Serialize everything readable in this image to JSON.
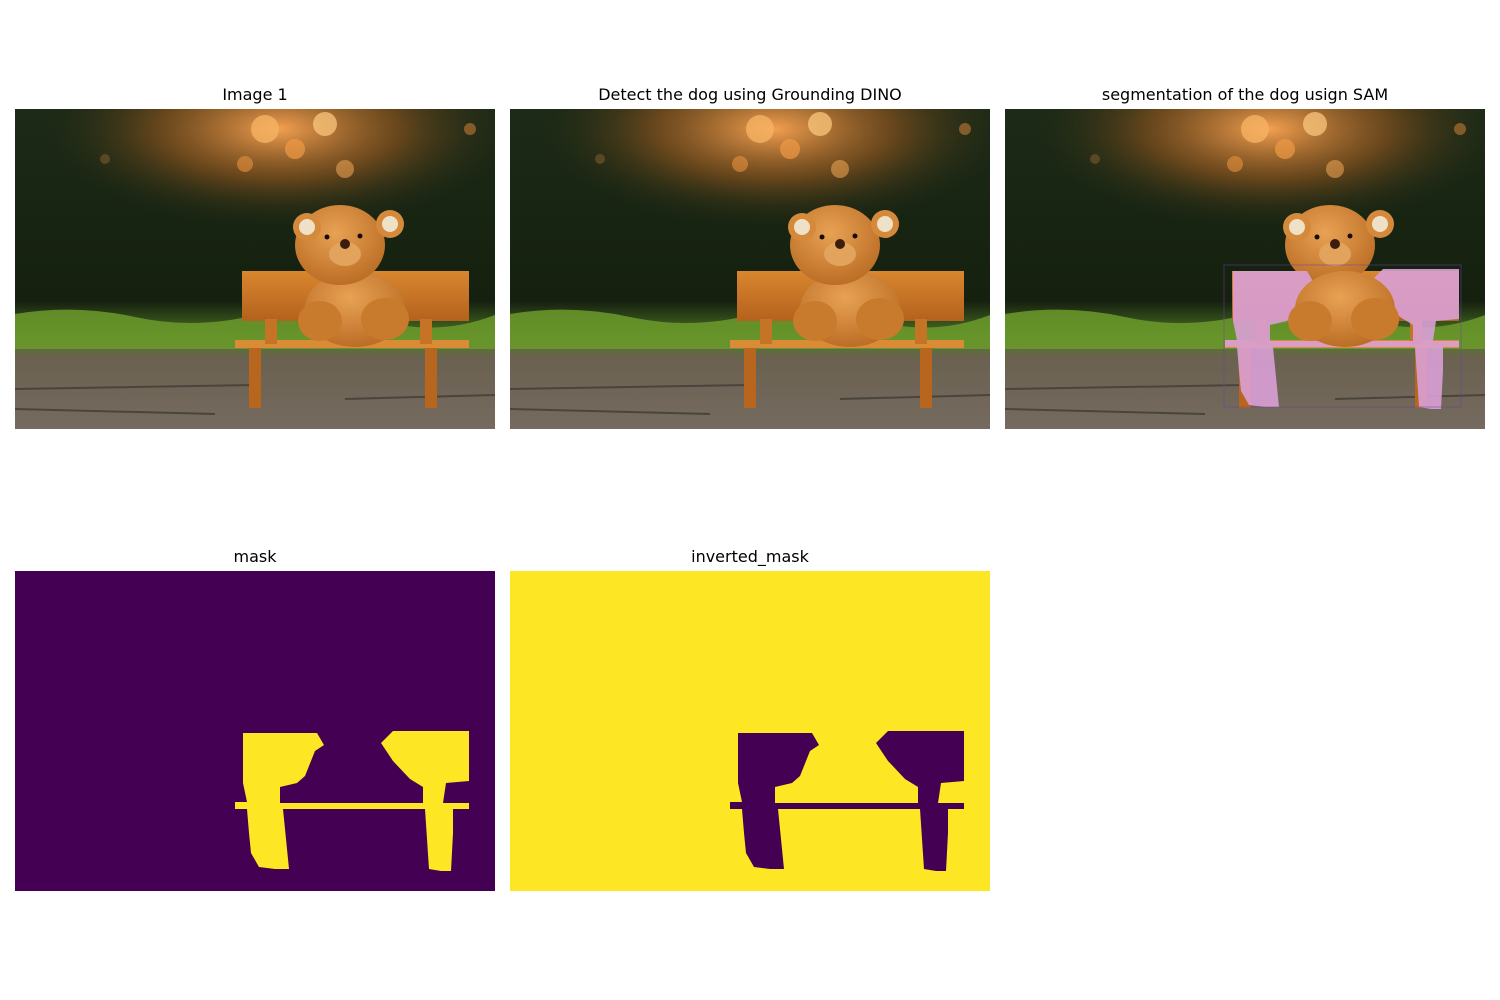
{
  "figure": {
    "panels": [
      {
        "title": "Image 1",
        "content": "teddy-bear-on-bench-photo"
      },
      {
        "title": "Detect the dog using Grounding DINO",
        "content": "teddy-bear-on-bench-photo"
      },
      {
        "title": "segmentation of the dog usign SAM",
        "content": "teddy-bear-on-bench-photo-with-pink-segmentation-overlay"
      },
      {
        "title": "mask",
        "content": "binary-mask",
        "background_color": "#440154",
        "foreground_color": "#fde725"
      },
      {
        "title": "inverted_mask",
        "content": "binary-mask-inverted",
        "background_color": "#fde725",
        "foreground_color": "#440154"
      }
    ],
    "overlay_color": "#d9a0d6"
  }
}
